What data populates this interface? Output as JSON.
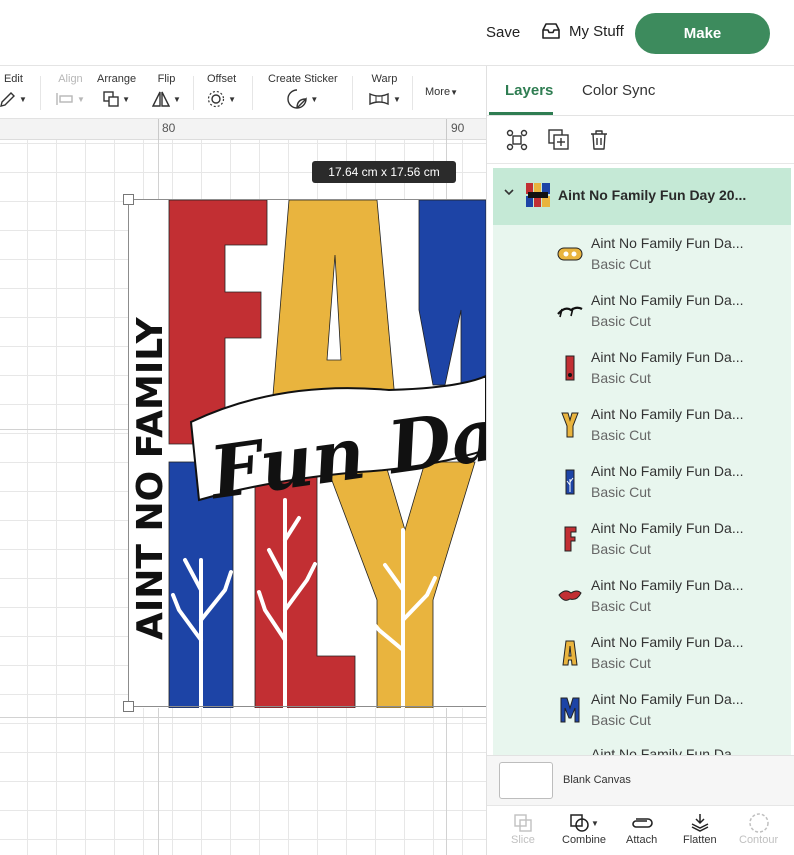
{
  "header": {
    "save_label": "Save",
    "mystuff_label": "My Stuff",
    "make_label": "Make"
  },
  "toolbar": {
    "edit": "Edit",
    "align": "Align",
    "arrange": "Arrange",
    "flip": "Flip",
    "offset": "Offset",
    "create_sticker": "Create Sticker",
    "warp": "Warp",
    "more": "More"
  },
  "ruler": {
    "mark_left": "80",
    "mark_right": "90"
  },
  "canvas": {
    "dimensions": "17.64  cm x 17.56  cm",
    "design_vertical_text": "AINT NO FAMILY",
    "design_script_text": "Fun Day"
  },
  "panel": {
    "tabs": [
      "Layers",
      "Color Sync"
    ],
    "group_name": "Aint No Family Fun Day 20...",
    "layers": [
      {
        "name": "Aint No Family Fun Da...",
        "kind": "Basic Cut",
        "icon": "oval-yellow"
      },
      {
        "name": "Aint No Family Fun Da...",
        "kind": "Basic Cut",
        "icon": "script-black"
      },
      {
        "name": "Aint No Family Fun Da...",
        "kind": "Basic Cut",
        "icon": "bar-red"
      },
      {
        "name": "Aint No Family Fun Da...",
        "kind": "Basic Cut",
        "icon": "y-yellow"
      },
      {
        "name": "Aint No Family Fun Da...",
        "kind": "Basic Cut",
        "icon": "bar-blue"
      },
      {
        "name": "Aint No Family Fun Da...",
        "kind": "Basic Cut",
        "icon": "f-red"
      },
      {
        "name": "Aint No Family Fun Da...",
        "kind": "Basic Cut",
        "icon": "swirl-red"
      },
      {
        "name": "Aint No Family Fun Da...",
        "kind": "Basic Cut",
        "icon": "a-yellow"
      },
      {
        "name": "Aint No Family Fun Da...",
        "kind": "Basic Cut",
        "icon": "m-blue"
      },
      {
        "name": "Aint No Family Fun Da...",
        "kind": "",
        "icon": "partial"
      }
    ],
    "blank_canvas": "Blank Canvas",
    "bottom_tools": [
      "Slice",
      "Combine",
      "Attach",
      "Flatten",
      "Contour"
    ]
  },
  "colors": {
    "accent_green": "#3d8b5d",
    "design_red": "#c22f33",
    "design_yellow": "#e9b43e",
    "design_blue": "#1d44a6"
  }
}
